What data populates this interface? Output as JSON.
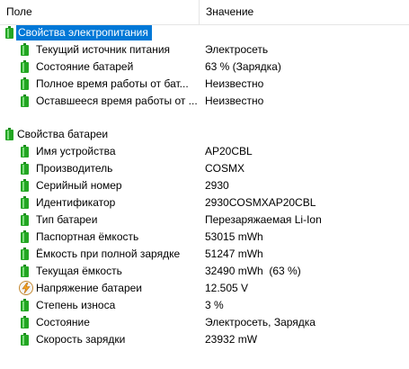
{
  "header": {
    "col_field": "Поле",
    "col_value": "Значение"
  },
  "groups": [
    {
      "title": "Свойства электропитания",
      "rows": [
        {
          "name": "Текущий источник питания",
          "value": "Электросеть"
        },
        {
          "name": "Состояние батарей",
          "value": "63 % (Зарядка)"
        },
        {
          "name": "Полное время работы от батарей",
          "value": "Неизвестно"
        },
        {
          "name": "Оставшееся время работы от батарей",
          "value": "Неизвестно"
        }
      ]
    },
    {
      "title": "Свойства батареи",
      "rows": [
        {
          "name": "Имя устройства",
          "value": "AP20CBL"
        },
        {
          "name": "Производитель",
          "value": "COSMX"
        },
        {
          "name": "Серийный номер",
          "value": "2930"
        },
        {
          "name": "Идентификатор",
          "value": "2930COSMXAP20CBL"
        },
        {
          "name": "Тип батареи",
          "value": "Перезаряжаемая Li-Ion"
        },
        {
          "name": "Паспортная ёмкость",
          "value": "53015 mWh"
        },
        {
          "name": "Ёмкость при полной зарядке",
          "value": "51247 mWh"
        },
        {
          "name": "Текущая ёмкость",
          "value": "32490 mWh  (63 %)"
        },
        {
          "name": "Напряжение батареи",
          "value": "12.505 V"
        },
        {
          "name": "Степень износа",
          "value": "3 %"
        },
        {
          "name": "Состояние",
          "value": "Электросеть, Зарядка"
        },
        {
          "name": "Скорость зарядки",
          "value": "23932 mW"
        }
      ]
    }
  ],
  "display": {
    "g1_rows": [
      "Текущий источник питания",
      "Состояние батарей",
      "Полное время работы от бат...",
      "Оставшееся время работы от ..."
    ]
  },
  "colors": {
    "selection": "#0078d7",
    "battery": "#23a623"
  },
  "icons": {
    "battery": "battery-icon",
    "voltage": "lightning-icon"
  }
}
